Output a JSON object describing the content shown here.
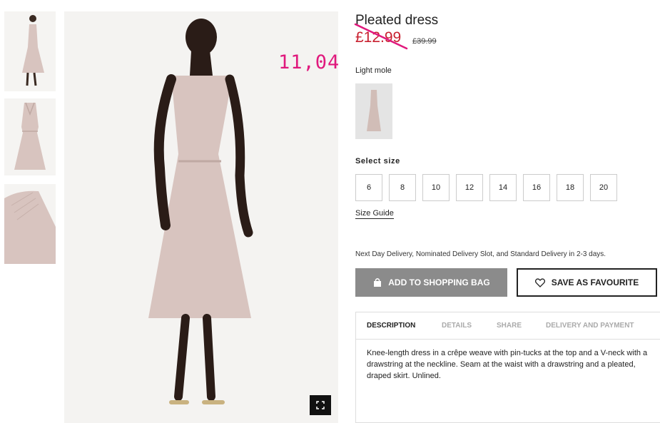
{
  "product": {
    "title": "Pleated dress",
    "sale_price": "£12.99",
    "old_price": "£39.99",
    "handwritten_note": "11,04",
    "color_name": "Light mole"
  },
  "sizes": {
    "label": "Select size",
    "options": [
      "6",
      "8",
      "10",
      "12",
      "14",
      "16",
      "18",
      "20"
    ],
    "guide_label": "Size Guide"
  },
  "delivery_text": "Next Day Delivery, Nominated Delivery Slot, and Standard Delivery in 2-3 days.",
  "actions": {
    "add_to_bag": "ADD TO SHOPPING BAG",
    "save_favourite": "SAVE AS FAVOURITE"
  },
  "tabs": [
    {
      "label": "DESCRIPTION",
      "active": true
    },
    {
      "label": "DETAILS",
      "active": false
    },
    {
      "label": "SHARE",
      "active": false
    },
    {
      "label": "DELIVERY AND PAYMENT",
      "active": false
    }
  ],
  "description": "Knee-length dress in a crêpe weave with pin-tucks at the top and a V-neck with a drawstring at the neckline. Seam at the waist with a drawstring and a pleated, draped skirt. Unlined.",
  "colors": {
    "sale": "#c8202f",
    "dress": "#d8c4bf",
    "annotation": "#e0197d",
    "button_grey": "#8b8b8b"
  }
}
